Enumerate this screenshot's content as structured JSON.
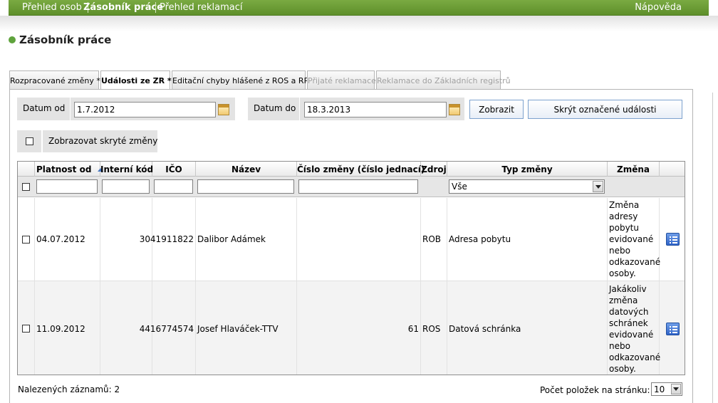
{
  "nav": {
    "items": [
      "Přehled osob",
      "Zásobník práce",
      "Přehled reklamací"
    ],
    "help": "Nápověda"
  },
  "page": {
    "title": "Zásobník práce"
  },
  "tabs": [
    {
      "label": "Rozpracované změny *"
    },
    {
      "label": "Události ze ZR *"
    },
    {
      "label": "Editační chyby hlášené z ROS a RPP"
    },
    {
      "label": "Přijaté reklamace"
    },
    {
      "label": "Reklamace do Základních registrů"
    }
  ],
  "filter": {
    "date_from_label": "Datum od",
    "date_from_value": "1.7.2012",
    "date_to_label": "Datum do",
    "date_to_value": "18.3.2013",
    "show_button": "Zobrazit",
    "hide_button": "Skrýt označené události",
    "show_hidden_label": "Zobrazovat skryté změny"
  },
  "table": {
    "columns": [
      "Platnost od",
      "Interní kód",
      "IČO",
      "Název",
      "Číslo změny (číslo jednací)",
      "Zdroj",
      "Typ změny",
      "Změna"
    ],
    "type_filter_value": "Vše",
    "rows": [
      {
        "date": "04.07.2012",
        "code": "30",
        "ico": "41911822",
        "name": "Dalibor Adámek",
        "change_no": "",
        "source": "ROB",
        "type": "Adresa pobytu",
        "change": "Změna adresy pobytu evidované nebo odkazované osoby."
      },
      {
        "date": "11.09.2012",
        "code": "44",
        "ico": "16774574",
        "name": "Josef Hlaváček-TTV",
        "change_no": "61",
        "source": "ROS",
        "type": "Datová schránka",
        "change": "Jakákoliv změna datových schránek evidované nebo odkazované osoby."
      }
    ]
  },
  "footer": {
    "found_label": "Nalezených záznamů: 2",
    "page_size_label": "Počet položek na stránku:",
    "page_size_value": "10"
  }
}
